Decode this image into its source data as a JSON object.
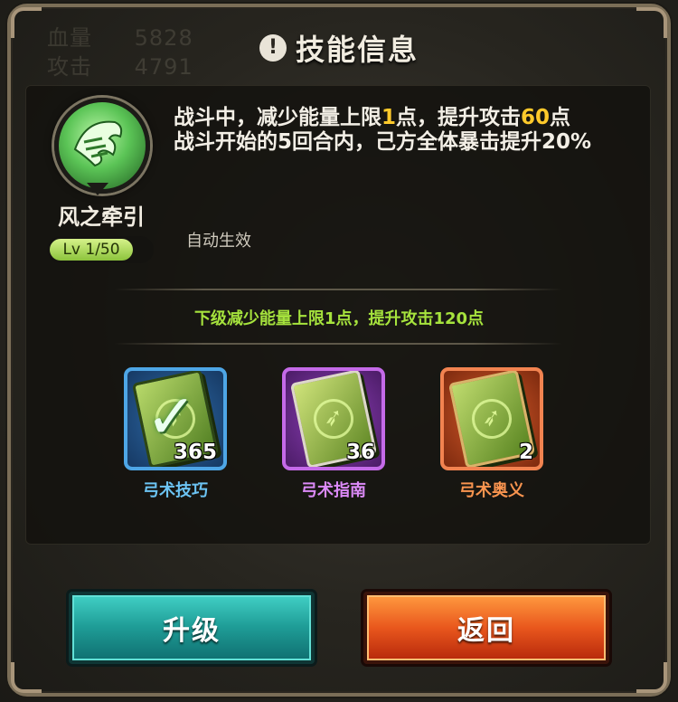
{
  "window": {
    "title": "技能信息"
  },
  "background_stats": [
    {
      "label": "血量",
      "value": "5828"
    },
    {
      "label": "攻击",
      "value": "4791"
    }
  ],
  "skill": {
    "name": "风之牵引",
    "level": "Lv 1/50",
    "level_progress": 0.02,
    "description_line1_prefix": "战斗中，减少能量上限",
    "description_line1_num1": "1",
    "description_line1_mid": "点，提升攻击",
    "description_line1_num2": "60",
    "description_line1_suffix": "点",
    "description_line2": "战斗开始的5回合内，己方全体暴击提升20%",
    "trigger": "自动生效",
    "next_level": "下级减少能量上限1点，提升攻击120点"
  },
  "books": [
    {
      "name": "弓术技巧",
      "count": "365",
      "selected": true,
      "rarity_color": "#4ea6e6"
    },
    {
      "name": "弓术指南",
      "count": "36",
      "selected": false,
      "rarity_color": "#c46ae8"
    },
    {
      "name": "弓术奥义",
      "count": "2",
      "selected": false,
      "rarity_color": "#f28350"
    }
  ],
  "buttons": {
    "upgrade": "升级",
    "back": "返回"
  },
  "colors": {
    "highlight": "#ffca2b",
    "next_level": "#a6e33d",
    "upgrade_button": "#1f9d97",
    "back_button": "#e9571d"
  },
  "icons": {
    "title_icon": "exclamation-icon",
    "skill_icon": "tiger-spirit-icon",
    "book_icon": "bow-book-icon",
    "selected_mark": "checkmark-icon"
  }
}
